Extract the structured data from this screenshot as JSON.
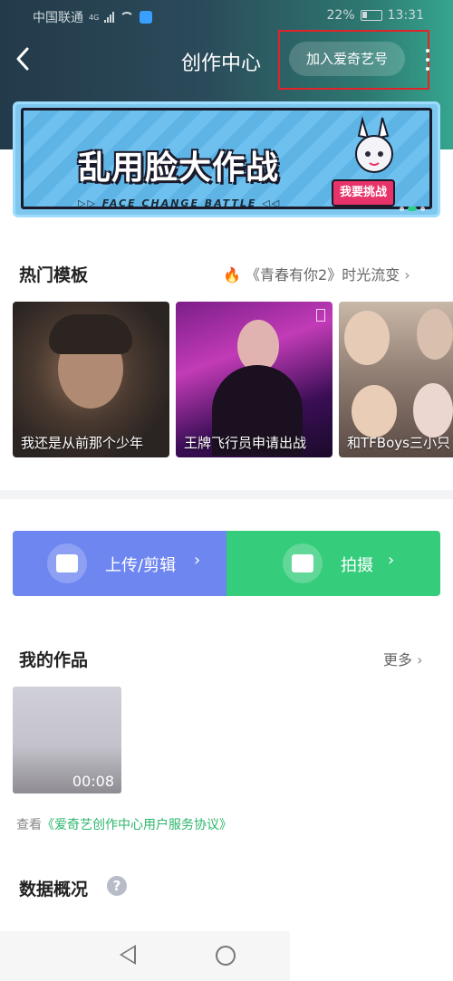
{
  "statusbar": {
    "carrier": "中国联通",
    "network": "4G",
    "battery": "22%",
    "time": "13:31"
  },
  "navbar": {
    "title": "创作中心",
    "join_label": "加入爱奇艺号"
  },
  "banner": {
    "title": "乱用脸大作战",
    "subtitle": "▷▷ FACE CHANGE BATTLE ◁◁",
    "cta": "我要挑战"
  },
  "hot_templates": {
    "title": "热门模板",
    "promo": "《青春有你2》时光流变",
    "items": [
      {
        "label": "我还是从前那个少年"
      },
      {
        "label": "王牌飞行员申请出战"
      },
      {
        "label": "和TFBoys三小只"
      }
    ]
  },
  "actions": {
    "upload": "上传/剪辑",
    "shoot": "拍摄"
  },
  "my_works": {
    "title": "我的作品",
    "more": "更多",
    "items": [
      {
        "duration": "00:08"
      }
    ]
  },
  "agreement": {
    "prefix": "查看",
    "link": "《爱奇艺创作中心用户服务协议》"
  },
  "data_overview": {
    "title": "数据概况",
    "help": "?"
  },
  "colors": {
    "accent_green": "#35cc7c",
    "accent_blue": "#6e86f0",
    "highlight_border": "#e0242a"
  }
}
